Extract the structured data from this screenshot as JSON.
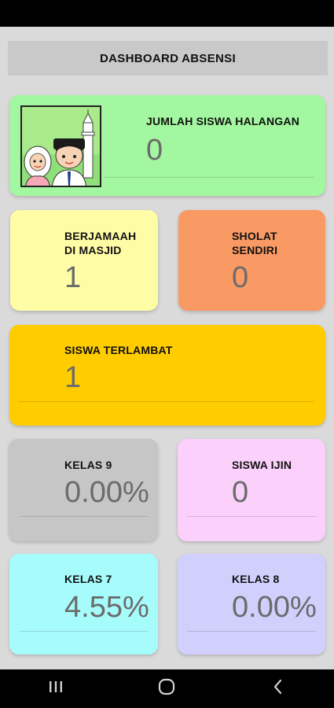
{
  "header": {
    "title": "DASHBOARD ABSENSI"
  },
  "cards": {
    "halangan": {
      "label": "JUMLAH SISWA HALANGAN",
      "value": "0"
    },
    "berjamaah": {
      "label": "BERJAMAAH\nDI MASJID",
      "value": "1"
    },
    "sendiri": {
      "label": "SHOLAT\nSENDIRI",
      "value": "0"
    },
    "terlambat": {
      "label": "SISWA TERLAMBAT",
      "value": "1"
    },
    "kelas9": {
      "label": "KELAS 9",
      "value": "0.00%"
    },
    "ijin": {
      "label": "SISWA IJIN",
      "value": "0"
    },
    "kelas7": {
      "label": "KELAS 7",
      "value": "4.55%"
    },
    "kelas8": {
      "label": "KELAS 8",
      "value": "0.00%"
    }
  },
  "colors": {
    "halangan": "#a3f7a0",
    "berjamaah": "#fffca6",
    "sendiri": "#f99963",
    "terlambat": "#ffcc00",
    "kelas9": "#c6c6c6",
    "ijin": "#fbd0fb",
    "kelas7": "#a6fcfb",
    "kelas8": "#d1d0fd"
  },
  "nav": {
    "recents_icon": "recents-icon",
    "home_icon": "home-icon",
    "back_icon": "back-icon"
  }
}
